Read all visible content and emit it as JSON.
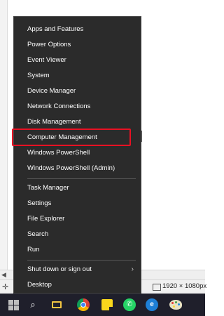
{
  "menu": {
    "items": [
      {
        "label": "Apps and Features"
      },
      {
        "label": "Power Options"
      },
      {
        "label": "Event Viewer"
      },
      {
        "label": "System"
      },
      {
        "label": "Device Manager"
      },
      {
        "label": "Network Connections"
      },
      {
        "label": "Disk Management"
      },
      {
        "label": "Computer Management"
      },
      {
        "label": "Windows PowerShell"
      },
      {
        "label": "Windows PowerShell (Admin)"
      },
      {
        "label": "Task Manager"
      },
      {
        "label": "Settings"
      },
      {
        "label": "File Explorer"
      },
      {
        "label": "Search"
      },
      {
        "label": "Run"
      },
      {
        "label": "Shut down or sign out"
      },
      {
        "label": "Desktop"
      }
    ],
    "highlighted_item": "Computer Management",
    "highlight_color": "#e81123",
    "background_color": "#2b2b2b"
  },
  "status_bar": {
    "dimensions": "1920 × 1080px"
  },
  "taskbar": {
    "icons": [
      "windows-start-icon",
      "search-icon",
      "task-view-icon",
      "chrome-icon",
      "sticky-notes-icon",
      "whatsapp-icon",
      "edge-icon",
      "paint-icon"
    ],
    "background_color": "#1f1f2b"
  }
}
